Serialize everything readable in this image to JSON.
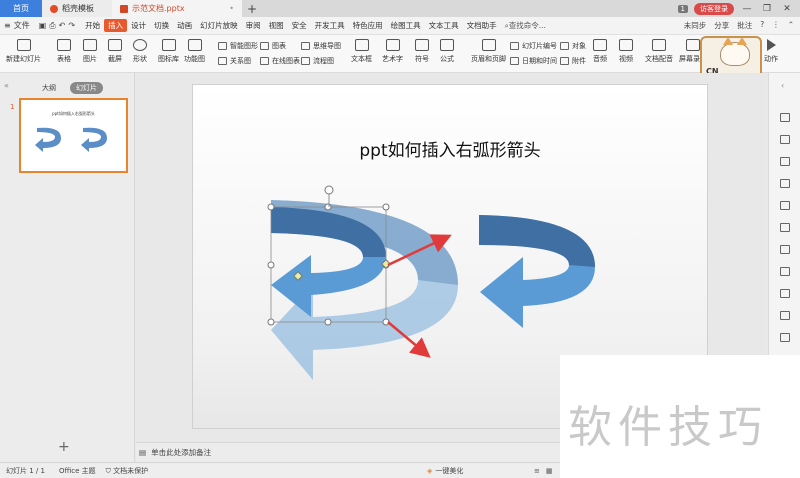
{
  "titlebar": {
    "tabs": [
      {
        "label": "首页"
      },
      {
        "label": "稻壳模板"
      },
      {
        "label": "示范文档.pptx"
      }
    ],
    "badge": "1",
    "visitor_label": "访客登录"
  },
  "menu": {
    "file_label": "文件",
    "items": [
      "开始",
      "插入",
      "设计",
      "切换",
      "动画",
      "幻灯片放映",
      "审阅",
      "视图",
      "安全",
      "开发工具",
      "特色应用",
      "绘图工具",
      "文本工具",
      "文档助手"
    ],
    "active": "插入",
    "search": "查找命令...",
    "right": [
      "未同步",
      "分享",
      "批注"
    ]
  },
  "ribbon": {
    "large": [
      "新建幻灯片",
      "表格",
      "图片",
      "截屏",
      "形状",
      "图标库",
      "功能图",
      "文本框",
      "艺术字",
      "符号",
      "公式",
      "页眉和页脚",
      "音频",
      "视频",
      "文档配音",
      "屏幕录制",
      "动作"
    ],
    "small_top": [
      "智能图形",
      "图表",
      "思维导图",
      "幻灯片编号",
      "对象"
    ],
    "small_bottom": [
      "关系图",
      "在线图表",
      "流程图",
      "日期和时间",
      "附件"
    ]
  },
  "mascot": {
    "text": "CN"
  },
  "left_panel": {
    "tabs": [
      "大纲",
      "幻灯片"
    ],
    "active_tab": "幻灯片",
    "slide_number": "1",
    "thumb_title": "ppt如何插入右弧形箭头"
  },
  "slide": {
    "title": "ppt如何插入右弧形箭头",
    "colors": {
      "arrow_dark": "#3f6fa3",
      "arrow_light": "#5b9bd5",
      "pointer": "#e03a3a",
      "selection": "#8a8a8a"
    }
  },
  "notes": {
    "placeholder": "单击此处添加备注"
  },
  "status": {
    "slide_info": "幻灯片 1 / 1",
    "theme": "Office 主题",
    "protect": "文档未保护",
    "beautify": "一键美化"
  },
  "watermark": {
    "text": "软件技巧"
  }
}
